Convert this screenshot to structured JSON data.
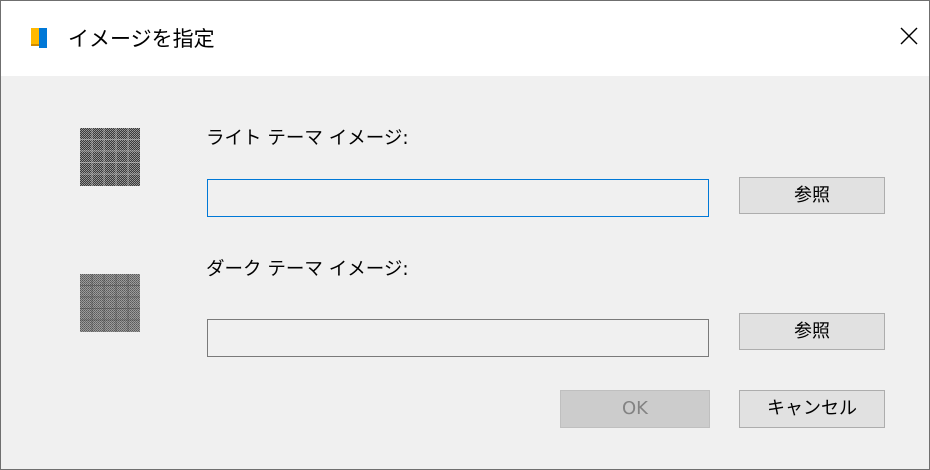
{
  "dialog": {
    "title": "イメージを指定",
    "icon": "app-book-icon",
    "close_icon": "close-icon"
  },
  "light_theme": {
    "label": "ライト テーマ イメージ:",
    "path_value": "",
    "browse_label": "参照"
  },
  "dark_theme": {
    "label": "ダーク テーマ イメージ:",
    "path_value": "",
    "browse_label": "参照"
  },
  "footer": {
    "ok_label": "OK",
    "ok_enabled": false,
    "cancel_label": "キャンセル"
  },
  "colors": {
    "focus_border": "#0078d7",
    "dialog_background": "#f0f0f0",
    "titlebar_background": "#ffffff"
  }
}
